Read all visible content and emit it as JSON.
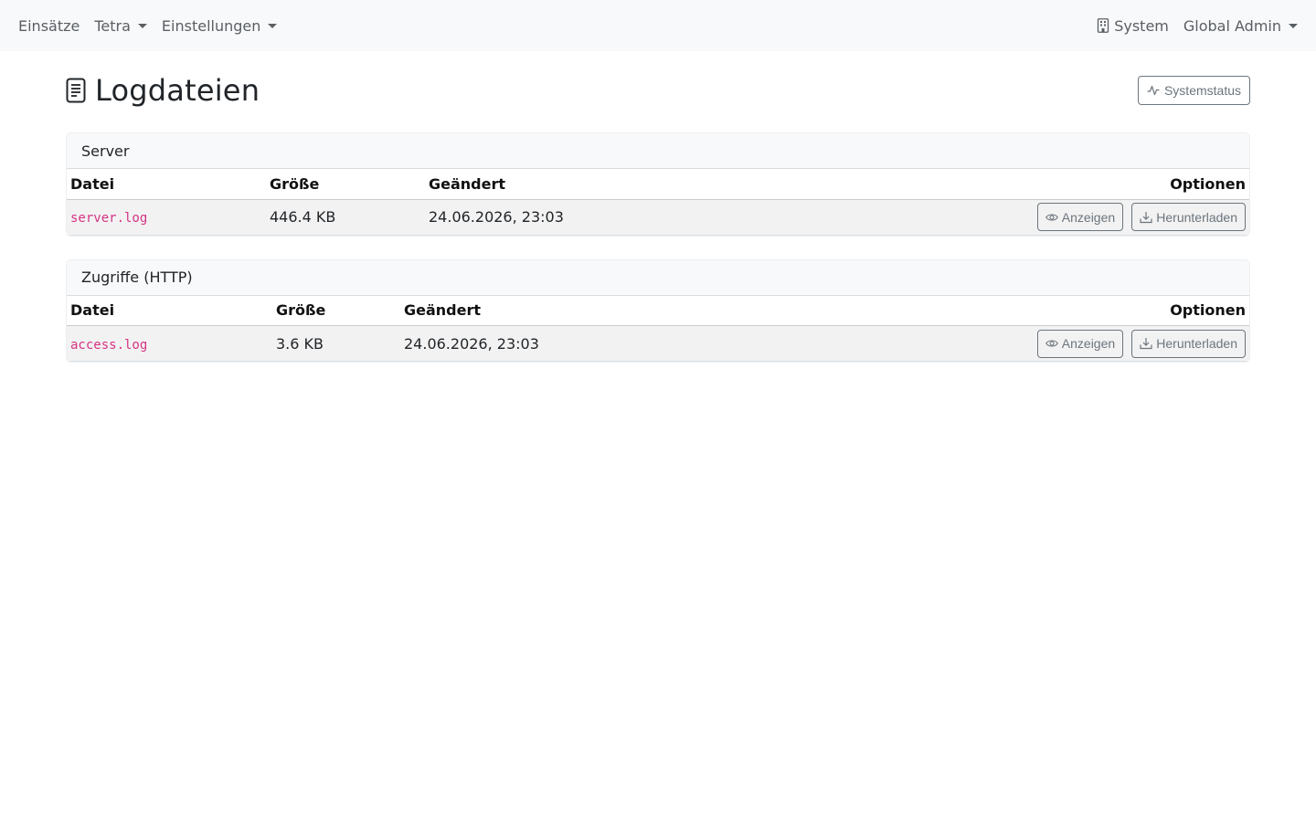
{
  "nav": {
    "left": [
      {
        "label": "Einsätze",
        "dropdown": false
      },
      {
        "label": "Tetra",
        "dropdown": true
      },
      {
        "label": "Einstellungen",
        "dropdown": true
      }
    ],
    "system_label": "System",
    "system_icon": "building-icon",
    "user_label": "Global Admin"
  },
  "page": {
    "title": "Logdateien",
    "title_icon": "document-icon",
    "status_button": "Systemstatus",
    "status_icon": "activity-icon"
  },
  "sections": [
    {
      "title": "Server",
      "columns": [
        "Datei",
        "Größe",
        "Geändert",
        "Optionen"
      ],
      "rows": [
        {
          "file": "server.log",
          "size": "446.4 KB",
          "modified": "24.06.2026, 23:03"
        }
      ]
    },
    {
      "title": "Zugriffe (HTTP)",
      "columns": [
        "Datei",
        "Größe",
        "Geändert",
        "Optionen"
      ],
      "rows": [
        {
          "file": "access.log",
          "size": "3.6 KB",
          "modified": "24.06.2026, 23:03"
        }
      ]
    }
  ],
  "buttons": {
    "view": "Anzeigen",
    "view_icon": "eye-icon",
    "download": "Herunterladen",
    "download_icon": "download-icon"
  },
  "colors": {
    "navbar_bg": "#f8f9fa",
    "filename": "#d63384",
    "button_outline": "#6c757d"
  }
}
